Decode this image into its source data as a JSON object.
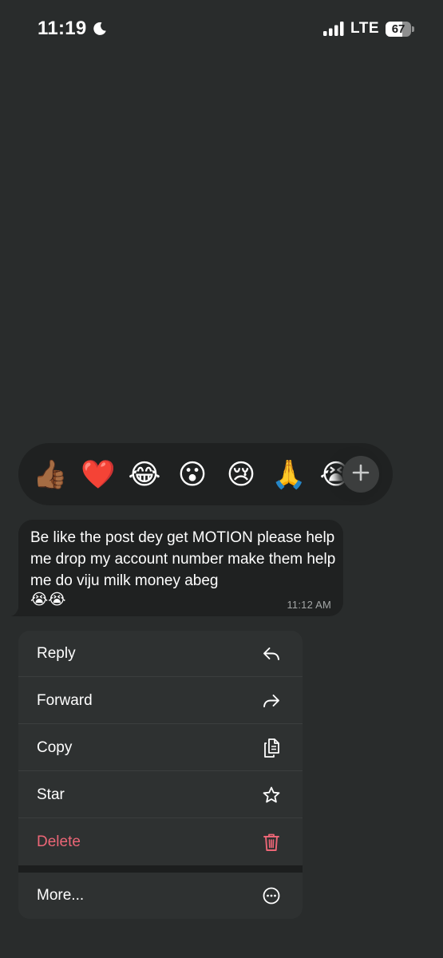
{
  "status_bar": {
    "time": "11:19",
    "network": "LTE",
    "battery_level": "67",
    "battery_fraction": 0.67
  },
  "reactions": {
    "emojis": [
      "👍🏾",
      "❤️",
      "😂",
      "😮",
      "😢",
      "🙏",
      "😭"
    ],
    "add_icon": "plus-icon"
  },
  "message": {
    "text": "Be like the post dey get MOTION please help me drop my account number make them help me do viju milk money abeg",
    "emojis": "😭😭",
    "timestamp": "11:12 AM"
  },
  "menu": {
    "items": [
      {
        "label": "Reply",
        "icon": "reply-icon"
      },
      {
        "label": "Forward",
        "icon": "forward-icon"
      },
      {
        "label": "Copy",
        "icon": "copy-icon"
      },
      {
        "label": "Star",
        "icon": "star-icon"
      },
      {
        "label": "Delete",
        "icon": "trash-icon"
      },
      {
        "label": "More...",
        "icon": "more-icon"
      }
    ]
  },
  "colors": {
    "background": "#292c2c",
    "bubble": "#1f2121",
    "menu": "#2e3131",
    "danger": "#ec6676"
  }
}
